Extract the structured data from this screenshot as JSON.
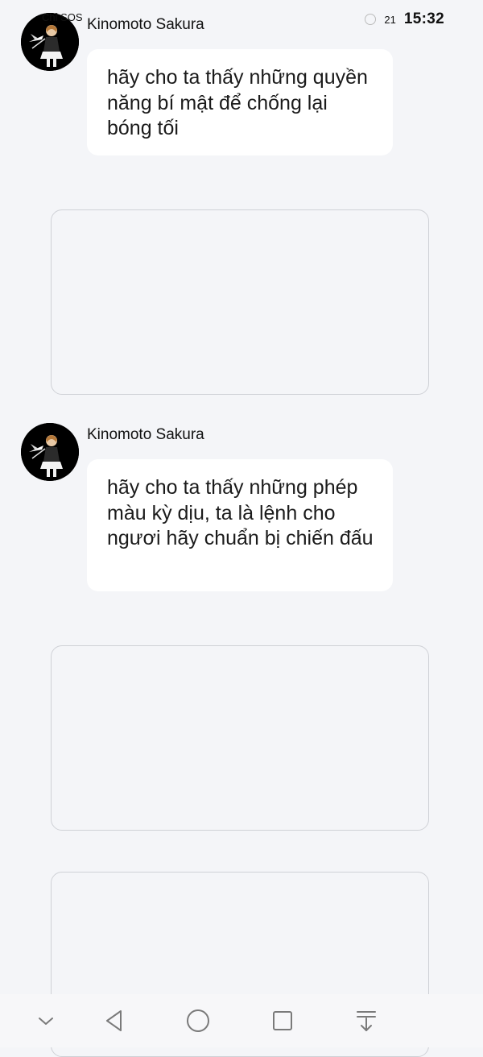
{
  "status_bar": {
    "left_text": "Chỉ SOS",
    "right_number": "21",
    "time": "15:32"
  },
  "messages": [
    {
      "sender": "Kinomoto Sakura",
      "text": "hãy cho ta thấy những quyền năng bí mật để chống lại bóng tối"
    },
    {
      "sender": "Kinomoto Sakura",
      "text": "hãy cho ta thấy những phép màu kỳ dịu, ta là lệnh cho ngươi hãy chuẩn bị chiến đấu"
    }
  ],
  "icons": {
    "avatar": "anime-avatar",
    "nav": [
      "chevron-down-icon",
      "back-triangle-icon",
      "home-circle-icon",
      "recents-square-icon",
      "notification-pull-icon"
    ]
  },
  "colors": {
    "background": "#f4f5f8",
    "bubble": "#ffffff",
    "card_border": "#cfd1d6",
    "nav_icon": "#7a7a7a"
  }
}
